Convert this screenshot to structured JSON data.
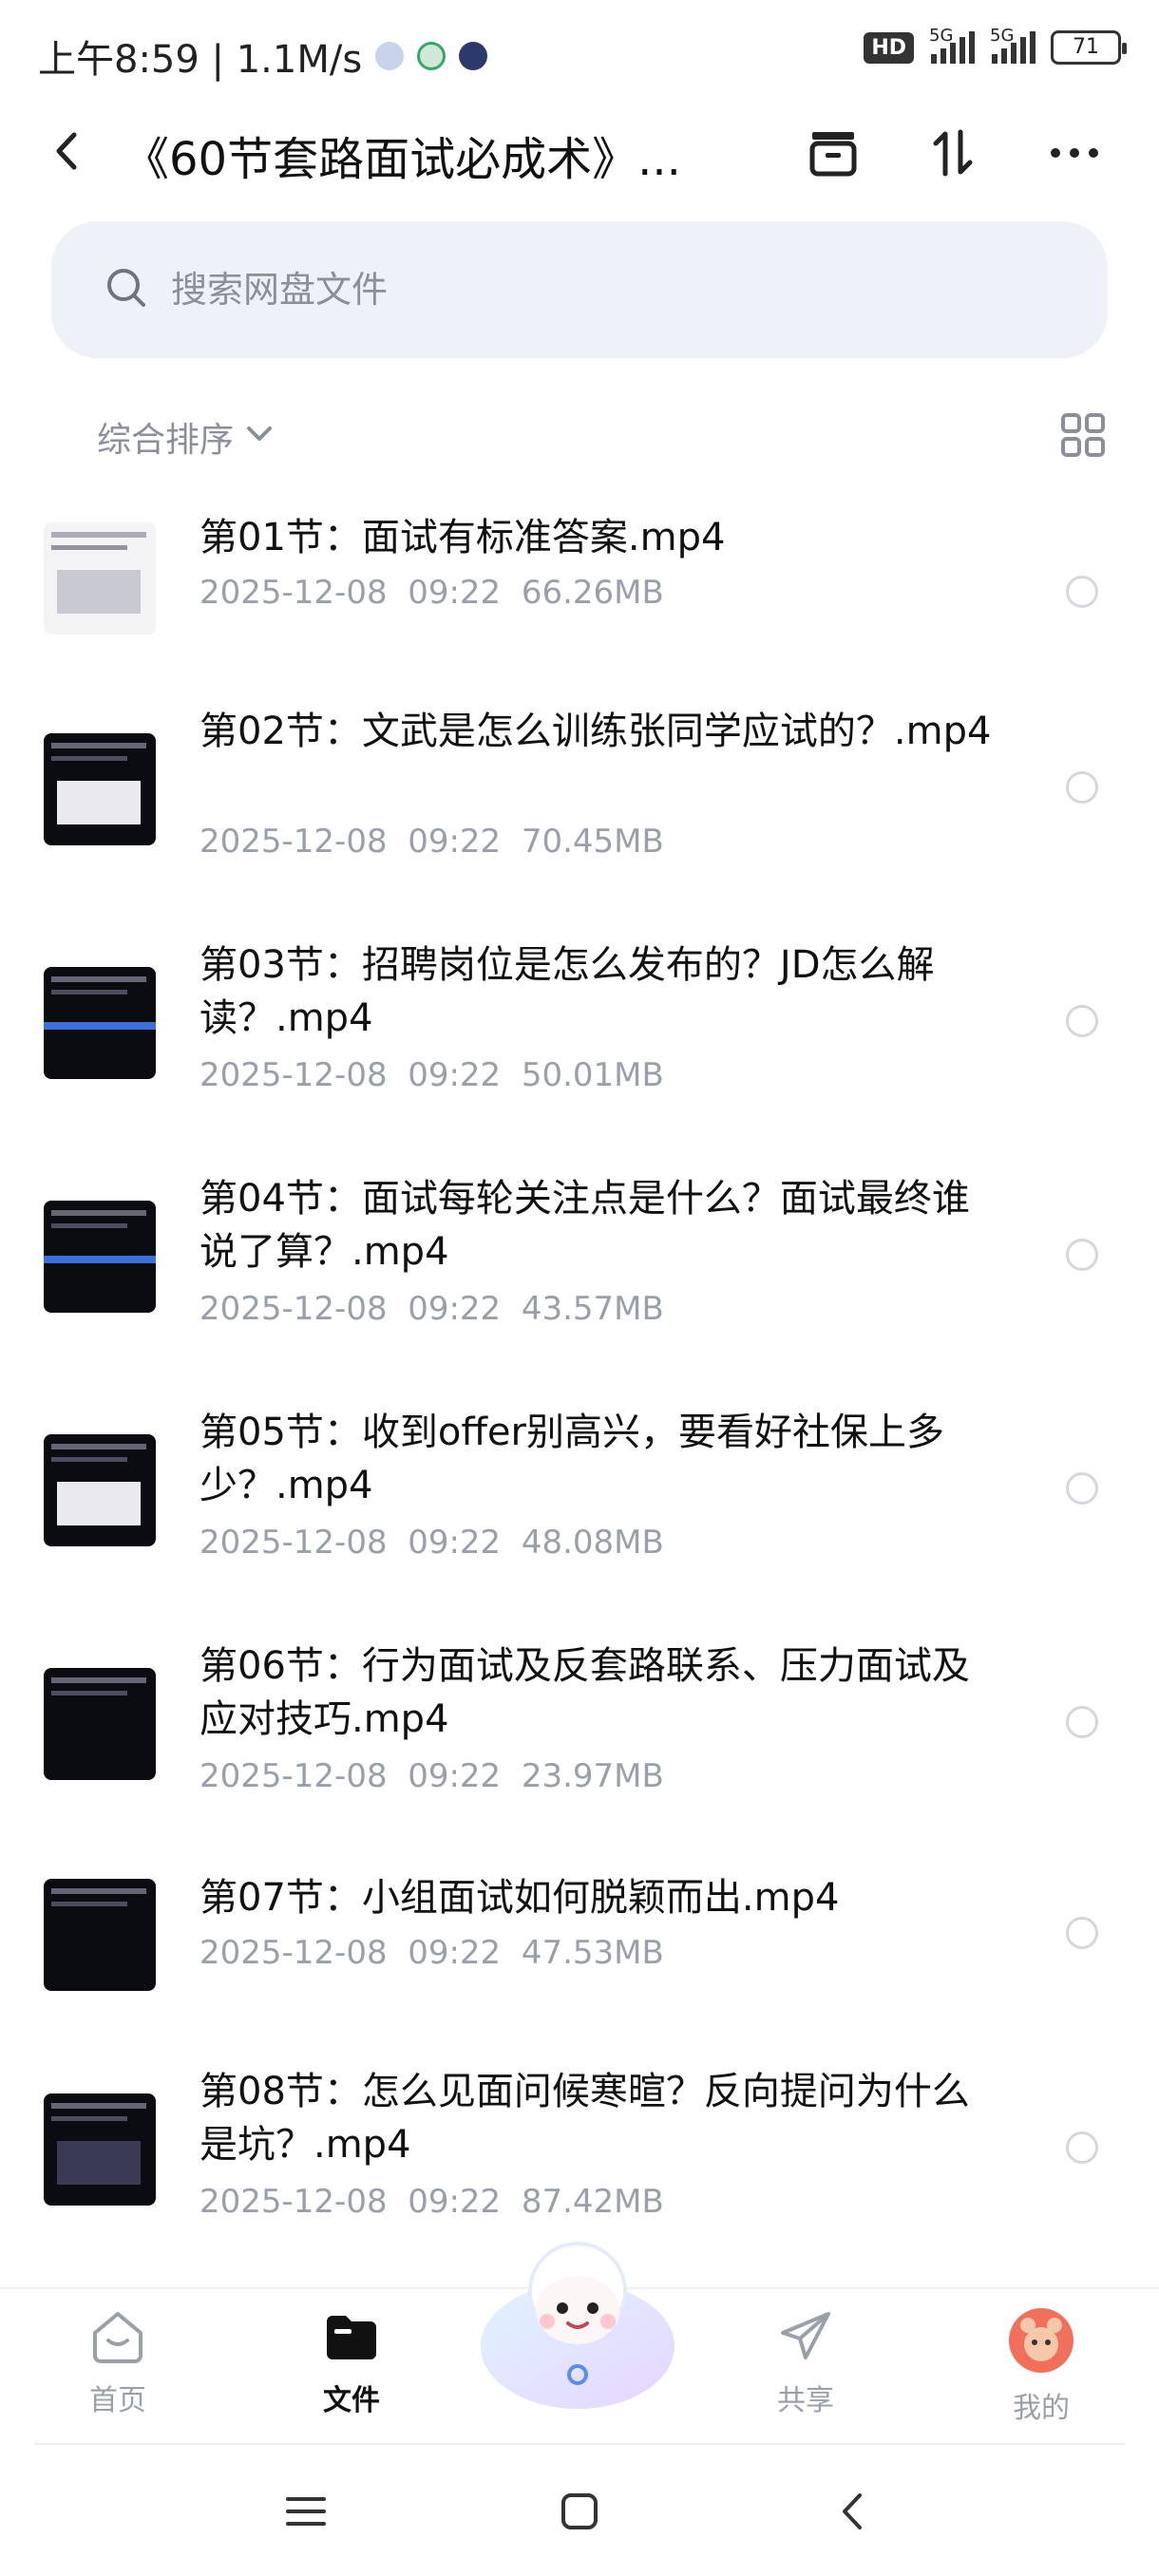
{
  "status_bar": {
    "time_speed": "上午8:59 | 1.1M/s",
    "hd_badge": "HD",
    "network_1": "5G",
    "network_2": "5G",
    "battery": "71"
  },
  "header": {
    "title": "《60节套路面试必成术》...",
    "icons": [
      "back-icon",
      "archive-icon",
      "sort-icon",
      "more-icon"
    ]
  },
  "search": {
    "placeholder": "搜索网盘文件"
  },
  "sort": {
    "label": "综合排序"
  },
  "files": [
    {
      "name": "第01节：面试有标准答案.mp4",
      "date": "2025-12-08  09:22",
      "size": "66.26MB"
    },
    {
      "name": "第02节：文武是怎么训练张同学应试的？.mp4",
      "date": "2025-12-08  09:22",
      "size": "70.45MB"
    },
    {
      "name": "第03节：招聘岗位是怎么发布的？JD怎么解读？.mp4",
      "date": "2025-12-08  09:22",
      "size": "50.01MB"
    },
    {
      "name": "第04节：面试每轮关注点是什么？面试最终谁说了算？.mp4",
      "date": "2025-12-08  09:22",
      "size": "43.57MB"
    },
    {
      "name": "第05节：收到offer别高兴，要看好社保上多少？.mp4",
      "date": "2025-12-08  09:22",
      "size": "48.08MB"
    },
    {
      "name": "第06节：行为面试及反套路联系、压力面试及应对技巧.mp4",
      "date": "2025-12-08  09:22",
      "size": "23.97MB"
    },
    {
      "name": "第07节：小组面试如何脱颖而出.mp4",
      "date": "2025-12-08  09:22",
      "size": "47.53MB"
    },
    {
      "name": "第08节：怎么见面问候寒暄？反向提问为什么是坑？.mp4",
      "date": "2025-12-08  09:22",
      "size": "87.42MB"
    }
  ],
  "bottom_nav": {
    "home": "首页",
    "files": "文件",
    "share": "共享",
    "me": "我的"
  },
  "colors": {
    "search_bg": "#eef1f8",
    "muted_text": "#9aa0aa",
    "primary_text": "#111111"
  }
}
